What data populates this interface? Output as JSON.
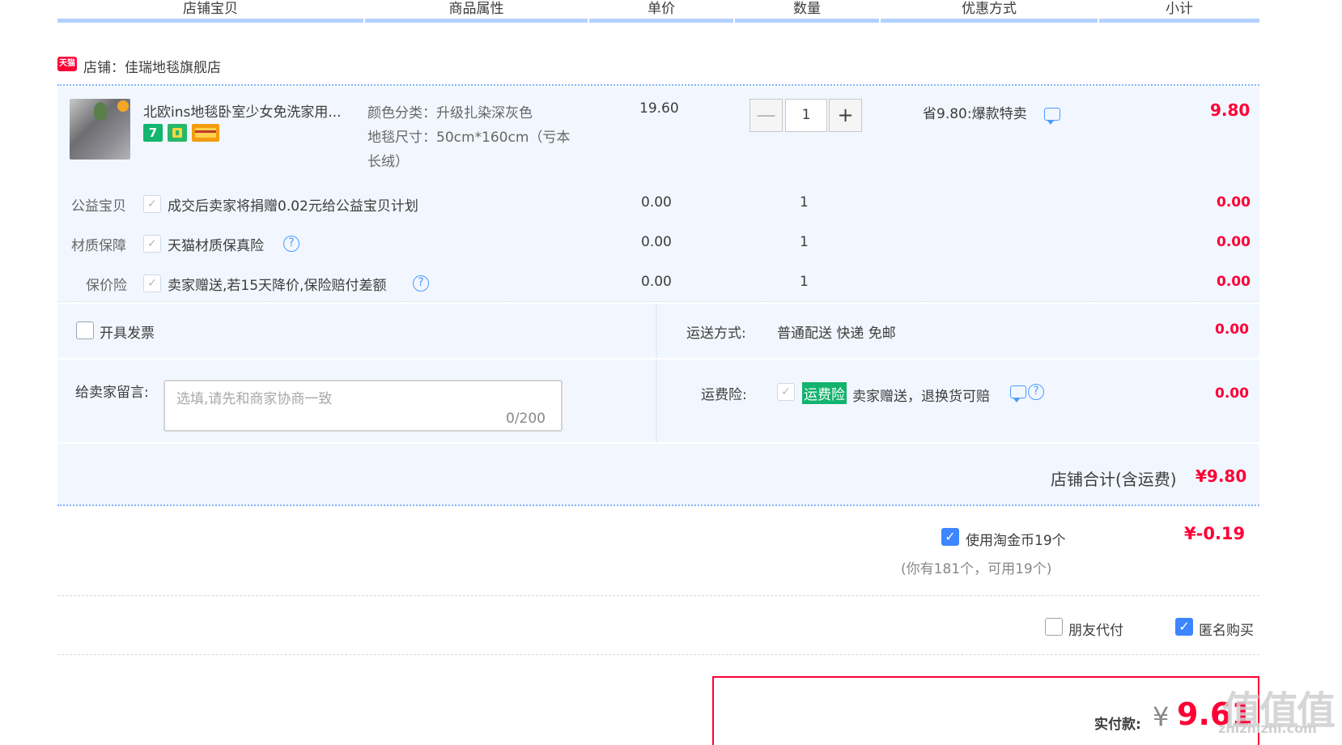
{
  "header": {
    "columns": [
      "店铺宝贝",
      "商品属性",
      "单价",
      "数量",
      "优惠方式",
      "小计"
    ]
  },
  "shop": {
    "logo_text": "天猫",
    "name": "店铺：佳瑞地毯旗舰店"
  },
  "item": {
    "title": "北欧ins地毯卧室少女免洗家用...",
    "badges": [
      "7"
    ],
    "attr_color": "颜色分类：升级扎染深灰色",
    "attr_size_1": "地毯尺寸：50cm*160cm（亏本",
    "attr_size_2": "长绒）",
    "price": "19.60",
    "quantity": "1",
    "minus_label": "—",
    "plus_label": "+",
    "discount": "省9.80:爆款特卖",
    "subtotal": "9.80"
  },
  "services": [
    {
      "label": "公益宝贝",
      "text": "成交后卖家将捐赠0.02元给公益宝贝计划",
      "price": "0.00",
      "qty": "1",
      "subtotal": "0.00"
    },
    {
      "label": "材质保障",
      "text": "天猫材质保真险",
      "price": "0.00",
      "qty": "1",
      "subtotal": "0.00"
    },
    {
      "label": "保价险",
      "text": "卖家赠送,若15天降价,保险赔付差额",
      "price": "0.00",
      "qty": "1",
      "subtotal": "0.00"
    }
  ],
  "invoice": {
    "label": "开具发票"
  },
  "shipping": {
    "label": "运送方式:",
    "value": "普通配送 快递 免邮",
    "price": "0.00"
  },
  "message": {
    "label": "给卖家留言:",
    "placeholder": "选填,请先和商家协商一致",
    "counter": "0/200"
  },
  "freight_insurance": {
    "label": "运费险:",
    "tag": "运费险",
    "text": "卖家赠送，退换货可赔",
    "price": "0.00"
  },
  "shop_total": {
    "label": "店铺合计(含运费)",
    "value": "¥9.80"
  },
  "coins": {
    "label": "使用淘金币19个",
    "note": "(你有181个，可用19个)",
    "value": "¥-0.19"
  },
  "options": {
    "friend_pay": "朋友代付",
    "anonymous": "匿名购买"
  },
  "payment": {
    "label": "实付款:",
    "currency": "¥",
    "value": "9.61"
  },
  "watermark": {
    "text": "值值值",
    "sub": "zhizhizhi.com"
  },
  "colors": {
    "accent_red": "#ff0036",
    "accent_blue": "#3d86ff",
    "header_bar": "#b2d1ff",
    "panel_bg": "#f2f7ff",
    "freight_tag": "#12b36d"
  }
}
